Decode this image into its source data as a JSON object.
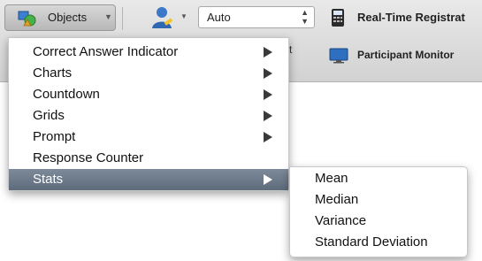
{
  "toolbar": {
    "objects_label": "Objects",
    "auto_value": "Auto",
    "realtime_label": "Real-Time Registrat",
    "participant_monitor_label": "Participant Monitor",
    "ghost_text": "t"
  },
  "menu": {
    "items": [
      {
        "label": "Correct Answer Indicator",
        "has_submenu": true
      },
      {
        "label": "Charts",
        "has_submenu": true
      },
      {
        "label": "Countdown",
        "has_submenu": true
      },
      {
        "label": "Grids",
        "has_submenu": true
      },
      {
        "label": "Prompt",
        "has_submenu": true
      },
      {
        "label": "Response Counter",
        "has_submenu": false
      },
      {
        "label": "Stats",
        "has_submenu": true,
        "selected": true
      }
    ]
  },
  "submenu": {
    "items": [
      {
        "label": "Mean"
      },
      {
        "label": "Median"
      },
      {
        "label": "Variance"
      },
      {
        "label": "Standard Deviation"
      }
    ]
  },
  "colors": {
    "selected_item": "#6b7888",
    "ribbon": "#dcdcdc"
  }
}
